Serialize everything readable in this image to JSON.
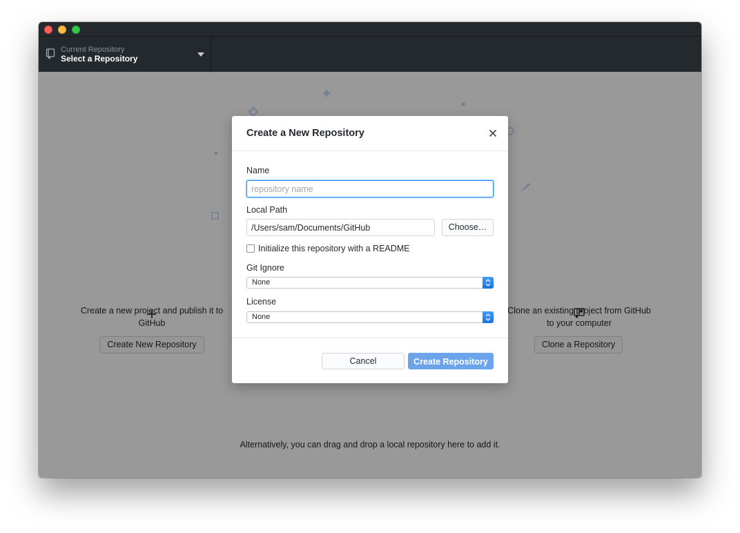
{
  "toolbar": {
    "repo_sub_label": "Current Repository",
    "repo_main_label": "Select a Repository"
  },
  "content": {
    "create_panel_text": "Create a new project and publish it to GitHub",
    "create_button": "Create New Repository",
    "clone_panel_text": "Clone an existing project from GitHub to your computer",
    "clone_button": "Clone a Repository",
    "alternative_text": "Alternatively, you can drag and drop a local repository here to add it."
  },
  "dialog": {
    "title": "Create a New Repository",
    "name_label": "Name",
    "name_placeholder": "repository name",
    "name_value": "",
    "local_path_label": "Local Path",
    "local_path_value": "/Users/sam/Documents/GitHub",
    "choose_button": "Choose…",
    "readme_label": "Initialize this repository with a README",
    "readme_checked": false,
    "gitignore_label": "Git Ignore",
    "gitignore_value": "None",
    "license_label": "License",
    "license_value": "None",
    "cancel_button": "Cancel",
    "create_button": "Create Repository"
  },
  "colors": {
    "toolbar_bg": "#24292e",
    "primary_button": "#6ba4ea",
    "focus_ring": "#2188ff",
    "overlay": "rgba(0,0,0,0.4)"
  },
  "icons": {
    "repo": "repo-icon",
    "caret": "triangle-down-icon",
    "close": "close-icon",
    "add": "plus-icon",
    "clone": "repo-clone-icon",
    "select": "select-arrows-icon"
  }
}
